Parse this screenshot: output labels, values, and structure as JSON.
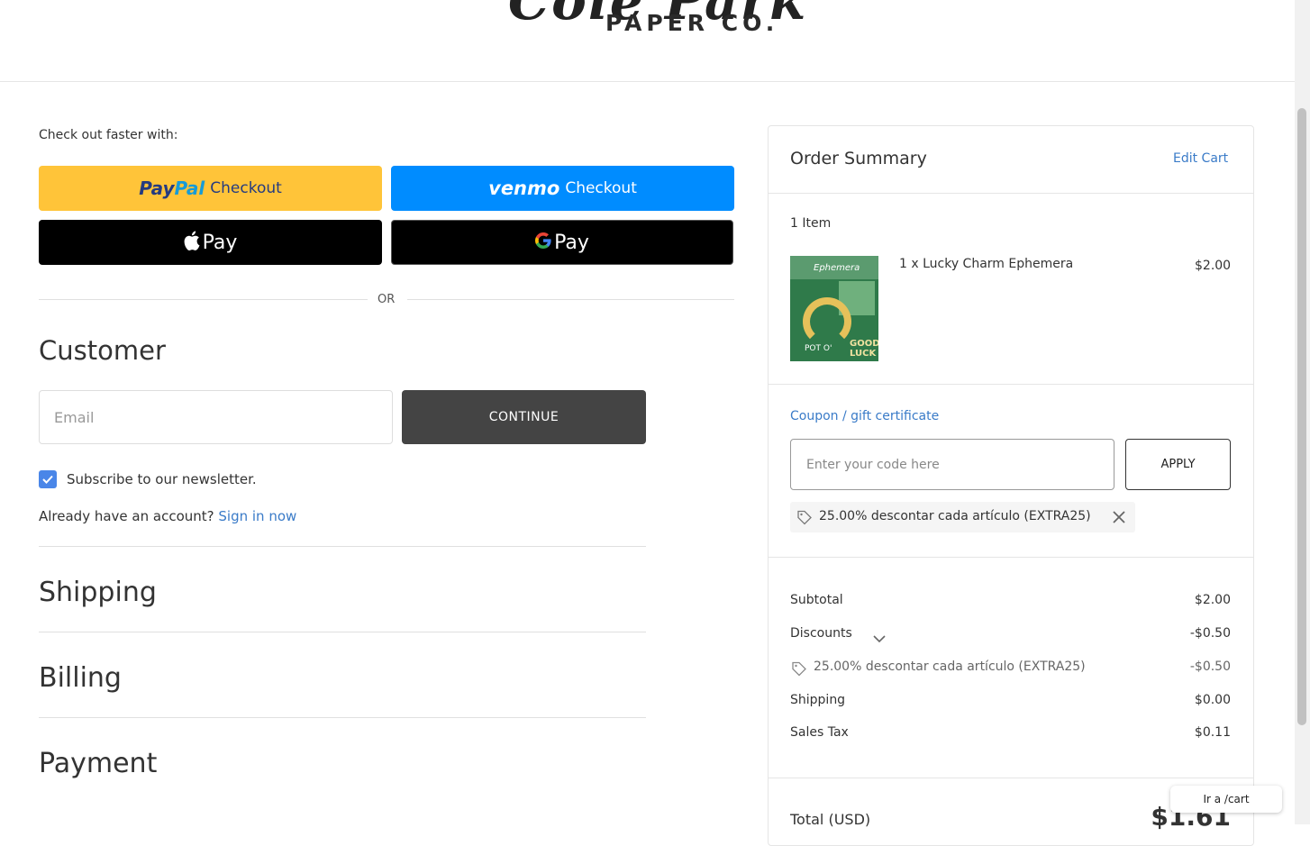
{
  "header": {
    "logo_script": "Cole Park",
    "logo_sub": "PAPER CO."
  },
  "express": {
    "label": "Check out faster with:",
    "paypal_logo_a": "Pay",
    "paypal_logo_b": "Pal",
    "paypal_checkout": "Checkout",
    "venmo_logo": "venmo",
    "venmo_checkout": "Checkout",
    "applepay_label": "Pay",
    "googlepay_label": "Pay",
    "googlepay_g": "G",
    "or": "OR"
  },
  "customer": {
    "title": "Customer",
    "email_placeholder": "Email",
    "continue_label": "CONTINUE",
    "newsletter_label": "Subscribe to our newsletter.",
    "newsletter_checked": true,
    "account_prompt": "Already have an account?",
    "sign_in_label": "Sign in now"
  },
  "sections": {
    "shipping": "Shipping",
    "billing": "Billing",
    "payment": "Payment"
  },
  "summary": {
    "title": "Order Summary",
    "edit_cart": "Edit Cart",
    "items_count": "1 Item",
    "item": {
      "name": "1 x Lucky Charm Ephemera",
      "price": "$2.00",
      "thumb_word": "Ephemera",
      "thumb_good": "GOOD LUCK",
      "thumb_pot": "POT O'"
    },
    "coupon_link": "Coupon / gift certificate",
    "coupon_placeholder": "Enter your code here",
    "apply_label": "APPLY",
    "applied_coupon": "25.00% descontar cada artículo (EXTRA25)",
    "rows": {
      "subtotal_label": "Subtotal",
      "subtotal_value": "$2.00",
      "discounts_label": "Discounts",
      "discounts_value": "-$0.50",
      "discount_line_label": "25.00% descontar cada artículo (EXTRA25)",
      "discount_line_value": "-$0.50",
      "shipping_label": "Shipping",
      "shipping_value": "$0.00",
      "tax_label": "Sales Tax",
      "tax_value": "$0.11"
    },
    "total_label": "Total (USD)",
    "total_value": "$1.61"
  },
  "tooltip": "Ir a /cart",
  "colors": {
    "accent_link": "#3a7bc8",
    "paypal_yellow": "#ffc439",
    "venmo_blue": "#008cff",
    "continue_bg": "#444444",
    "checkbox_blue": "#4a86e8"
  }
}
